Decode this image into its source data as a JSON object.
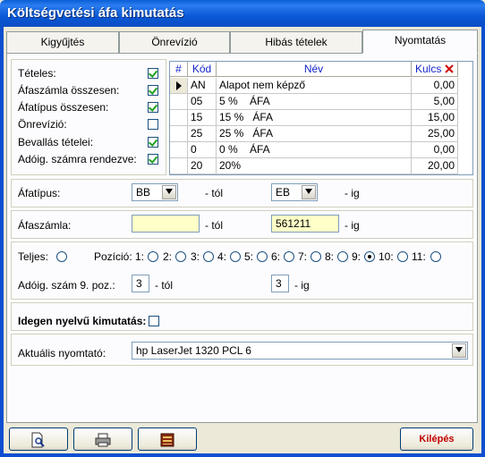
{
  "window": {
    "title": "Költségvetési áfa kimutatás"
  },
  "tabs": [
    "Kigyűjtés",
    "Önrevízió",
    "Hibás tételek",
    "Nyomtatás"
  ],
  "options": [
    {
      "label": "Tételes:",
      "checked": true
    },
    {
      "label": "Áfaszámla összesen:",
      "checked": true
    },
    {
      "label": "Áfatípus összesen:",
      "checked": true
    },
    {
      "label": "Önrevízió:",
      "checked": false
    },
    {
      "label": "Bevallás tételei:",
      "checked": true
    },
    {
      "label": "Adóig. számra rendezve:",
      "checked": true
    }
  ],
  "grid": {
    "headers": {
      "hash": "#",
      "code": "Kód",
      "name": "Név",
      "rate": "Kulcs"
    },
    "rows": [
      {
        "code": "AN",
        "name": "Alapot nem képző",
        "rate": "0,00"
      },
      {
        "code": "05",
        "name": "5 %    ÁFA",
        "rate": "5,00"
      },
      {
        "code": "15",
        "name": "15 %   ÁFA",
        "rate": "15,00"
      },
      {
        "code": "25",
        "name": "25 %   ÁFA",
        "rate": "25,00"
      },
      {
        "code": "0",
        "name": "0 %    ÁFA",
        "rate": "0,00"
      },
      {
        "code": "20",
        "name": "20%",
        "rate": "20,00"
      }
    ]
  },
  "afatipus": {
    "label": "Áfatípus:",
    "from": "BB",
    "from_suffix": "- tól",
    "to": "EB",
    "to_suffix": "- ig"
  },
  "afaszamla": {
    "label": "Áfaszámla:",
    "from": "",
    "from_suffix": "- tól",
    "to": "561211",
    "to_suffix": "- ig"
  },
  "position": {
    "teljes_label": "Teljes:",
    "pozicio_label": "Pozíció:",
    "items": [
      "1:",
      "2:",
      "3:",
      "4:",
      "5:",
      "6:",
      "7:",
      "8:",
      "9:",
      "10:",
      "11:"
    ],
    "selected_index": 9
  },
  "adoig": {
    "label": "Adóig. szám 9. poz.:",
    "from": "3",
    "from_suffix": "- tól",
    "to": "3",
    "to_suffix": "- ig"
  },
  "foreign": {
    "label": "Idegen nyelvű kimutatás:",
    "checked": false
  },
  "printer": {
    "label": "Aktuális nyomtató:",
    "value": "hp LaserJet 1320 PCL 6"
  },
  "buttons": {
    "exit": "Kilépés"
  },
  "icons": [
    "print-preview-icon",
    "printer-icon",
    "export-icon",
    "delete-column-icon"
  ],
  "colors": {
    "title_bar": "#0a5fd6",
    "header_text": "#1424c8",
    "input_yellow": "#ffffc8",
    "exit_text": "#c00000"
  }
}
